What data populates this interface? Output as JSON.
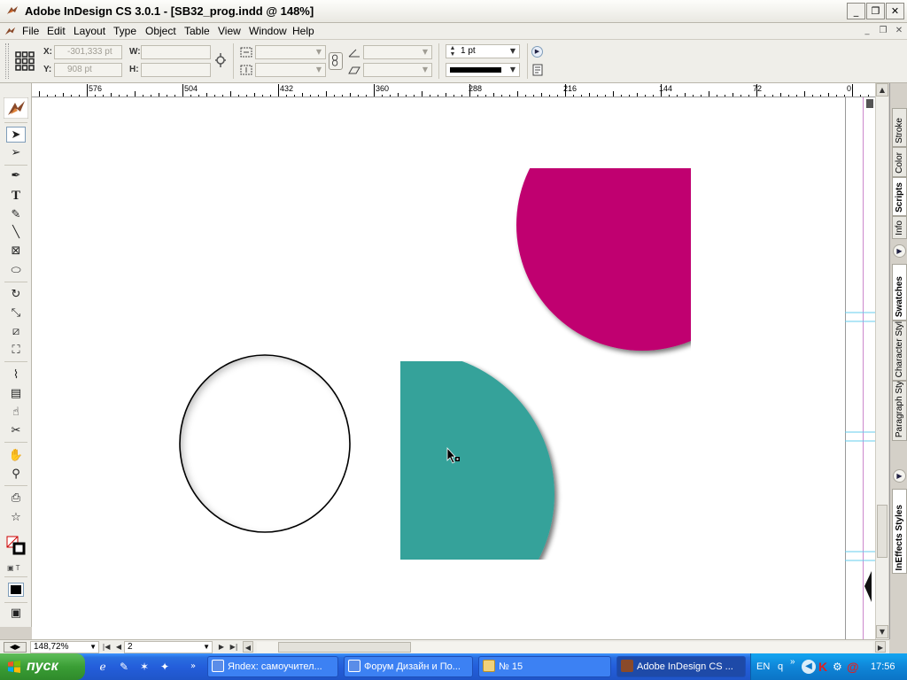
{
  "window": {
    "title": "Adobe InDesign CS 3.0.1 - [SB32_prog.indd @ 148%]",
    "buttons": {
      "minimize": "_",
      "restore": "❐",
      "close": "✕"
    }
  },
  "menu": {
    "items": [
      "File",
      "Edit",
      "Layout",
      "Type",
      "Object",
      "Table",
      "View",
      "Window",
      "Help"
    ]
  },
  "control_palette": {
    "x_label": "X:",
    "x_value": "-301,333 pt",
    "y_label": "Y:",
    "y_value": "908 pt",
    "w_label": "W:",
    "h_label": "H:",
    "stroke_weight": "1 pt"
  },
  "ruler": {
    "labels": [
      "576",
      "504",
      "432",
      "360",
      "288",
      "216",
      "144",
      "72",
      "0"
    ]
  },
  "colors": {
    "magenta_shape": "#c0006f",
    "teal_shape": "#36a29a"
  },
  "panel_tabs": [
    "Stroke",
    "Color",
    "Scripts",
    "Info",
    "Swatches",
    "Character Styl",
    "Paragraph Styl",
    "InEffects Styles"
  ],
  "status": {
    "zoom": "148,72%",
    "page": "2"
  },
  "taskbar": {
    "start_label": "пуск",
    "tasks": [
      {
        "label": "Яndex: самоучител...",
        "icon": "browser-icon"
      },
      {
        "label": "Форум Дизайн и По...",
        "icon": "browser-icon"
      },
      {
        "label": "№ 15",
        "icon": "folder-icon"
      },
      {
        "label": "Adobe InDesign CS ...",
        "icon": "indesign-icon"
      }
    ],
    "language": "EN",
    "tray_letter": "q",
    "clock": "17:56"
  }
}
